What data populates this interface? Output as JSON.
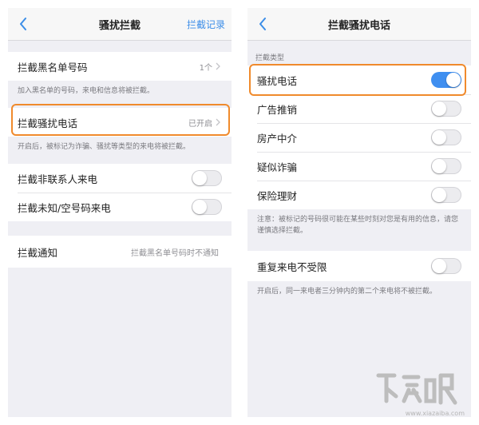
{
  "left": {
    "nav": {
      "title": "骚扰拦截",
      "right_action": "拦截记录"
    },
    "blacklist": {
      "label": "拦截黑名单号码",
      "value": "1个",
      "note": "加入黑名单的号码，来电和信息将被拦截。"
    },
    "harass": {
      "label": "拦截骚扰电话",
      "value": "已开启",
      "note": "开启后，被标记为诈骗、骚扰等类型的来电将被拦截。"
    },
    "toggles": [
      {
        "label": "拦截非联系人来电",
        "on": false
      },
      {
        "label": "拦截未知/空号码来电",
        "on": false
      }
    ],
    "notify": {
      "label": "拦截通知",
      "value": "拦截黑名单号码时不通知"
    }
  },
  "right": {
    "nav": {
      "title": "拦截骚扰电话"
    },
    "section_header": "拦截类型",
    "types": [
      {
        "label": "骚扰电话",
        "on": true
      },
      {
        "label": "广告推销",
        "on": false
      },
      {
        "label": "房产中介",
        "on": false
      },
      {
        "label": "疑似诈骗",
        "on": false
      },
      {
        "label": "保险理财",
        "on": false
      }
    ],
    "note": "注意：被标记的号码很可能在某些时刻对您是有用的信息，请您谨慎选择拦截。",
    "repeat": {
      "label": "重复来电不受限",
      "on": false,
      "note": "开启后，同一来电者三分钟内的第二个来电将不被拦截。"
    }
  },
  "colors": {
    "accent": "#3c8ee8",
    "highlight": "#f08a2c",
    "toggle_on": "#3f8ff0"
  },
  "watermark": {
    "sub": "www.xiazaiba.com"
  }
}
